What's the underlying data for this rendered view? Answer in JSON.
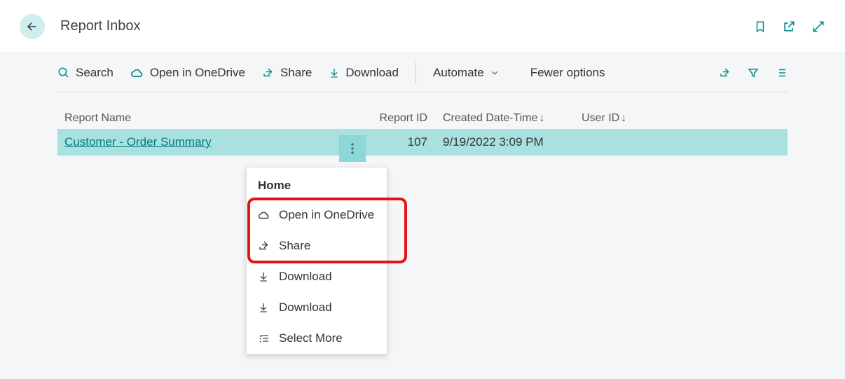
{
  "page": {
    "title": "Report Inbox"
  },
  "toolbar": {
    "search_label": "Search",
    "onedrive_label": "Open in OneDrive",
    "share_label": "Share",
    "download_label": "Download",
    "automate_label": "Automate",
    "fewer_label": "Fewer options"
  },
  "columns": {
    "name": "Report Name",
    "id": "Report ID",
    "date": "Created Date-Time",
    "user": "User ID"
  },
  "rows": [
    {
      "name": "Customer - Order Summary",
      "id": "107",
      "date": "9/19/2022 3:09 PM",
      "user": ""
    }
  ],
  "menu": {
    "title": "Home",
    "items": [
      {
        "icon": "cloud",
        "label": "Open in OneDrive"
      },
      {
        "icon": "share",
        "label": "Share"
      },
      {
        "icon": "download",
        "label": "Download"
      },
      {
        "icon": "download",
        "label": "Download"
      },
      {
        "icon": "list",
        "label": "Select More"
      }
    ]
  }
}
